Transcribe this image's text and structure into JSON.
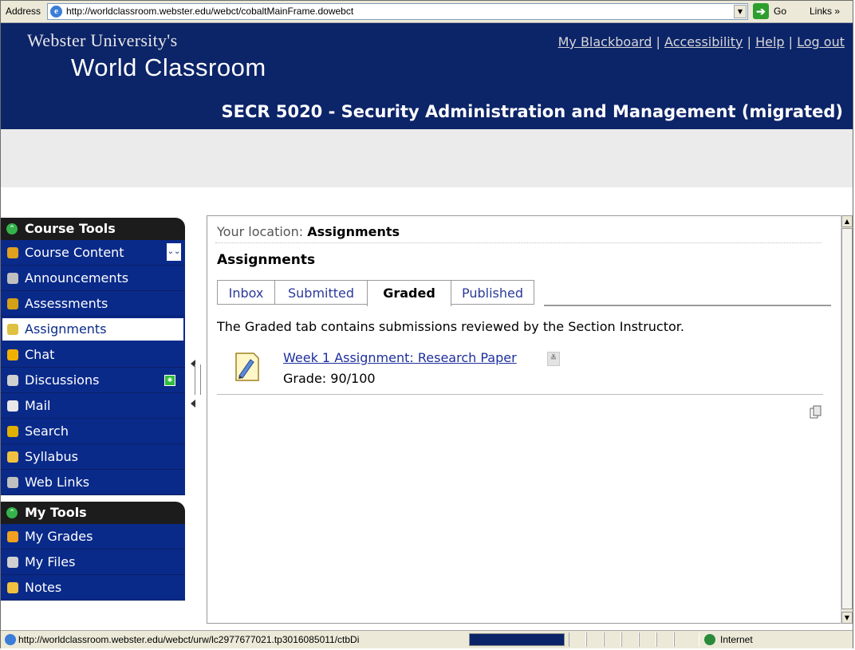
{
  "browser": {
    "address_label": "Address",
    "url": "http://worldclassroom.webster.edu/webct/cobaltMainFrame.dowebct",
    "go_label": "Go",
    "links_label": "Links »"
  },
  "header": {
    "brand_line1": "Webster University's",
    "brand_line2": "World Classroom",
    "top_links": [
      "My Blackboard",
      "Accessibility",
      "Help",
      "Log out"
    ],
    "link_separator": "|",
    "course_title": "SECR 5020 - Security Administration and Management (migrated)"
  },
  "sidebar": {
    "course_tools": {
      "title": "Course Tools",
      "items": [
        {
          "label": "Course Content",
          "icon": "home-icon",
          "color": "#e0a020"
        },
        {
          "label": "Announcements",
          "icon": "megaphone-icon",
          "color": "#c0c0c0"
        },
        {
          "label": "Assessments",
          "icon": "assessment-icon",
          "color": "#d4a017"
        },
        {
          "label": "Assignments",
          "icon": "assignment-icon",
          "color": "#e0c040",
          "active": true
        },
        {
          "label": "Chat",
          "icon": "chat-icon",
          "color": "#f0b000"
        },
        {
          "label": "Discussions",
          "icon": "pushpin-icon",
          "color": "#d0d0d0"
        },
        {
          "label": "Mail",
          "icon": "envelope-icon",
          "color": "#e8e8e8"
        },
        {
          "label": "Search",
          "icon": "magnifier-icon",
          "color": "#e0b000"
        },
        {
          "label": "Syllabus",
          "icon": "syllabus-icon",
          "color": "#f0c040"
        },
        {
          "label": "Web Links",
          "icon": "globe-icon",
          "color": "#c0c0c0"
        }
      ]
    },
    "my_tools": {
      "title": "My Tools",
      "items": [
        {
          "label": "My Grades",
          "icon": "grades-icon",
          "color": "#f0a020"
        },
        {
          "label": "My Files",
          "icon": "files-icon",
          "color": "#d0d0d0"
        },
        {
          "label": "Notes",
          "icon": "notes-icon",
          "color": "#f0c040"
        }
      ]
    }
  },
  "content": {
    "location_label": "Your location:",
    "location_value": "Assignments",
    "page_title": "Assignments",
    "tabs": [
      "Inbox",
      "Submitted",
      "Graded",
      "Published"
    ],
    "active_tab": "Graded",
    "description": "The Graded tab contains submissions reviewed by the Section Instructor.",
    "assignment": {
      "title": "Week 1 Assignment: Research Paper",
      "grade": "Grade: 90/100"
    }
  },
  "statusbar": {
    "url": "http://worldclassroom.webster.edu/webct/urw/lc2977677021.tp3016085011/ctbDi",
    "zone": "Internet"
  },
  "colors": {
    "header_bg": "#0c2468",
    "nav_bg": "#0a2a8a",
    "section_head_bg": "#1c1c1c",
    "link_color": "#1e2f9e"
  }
}
